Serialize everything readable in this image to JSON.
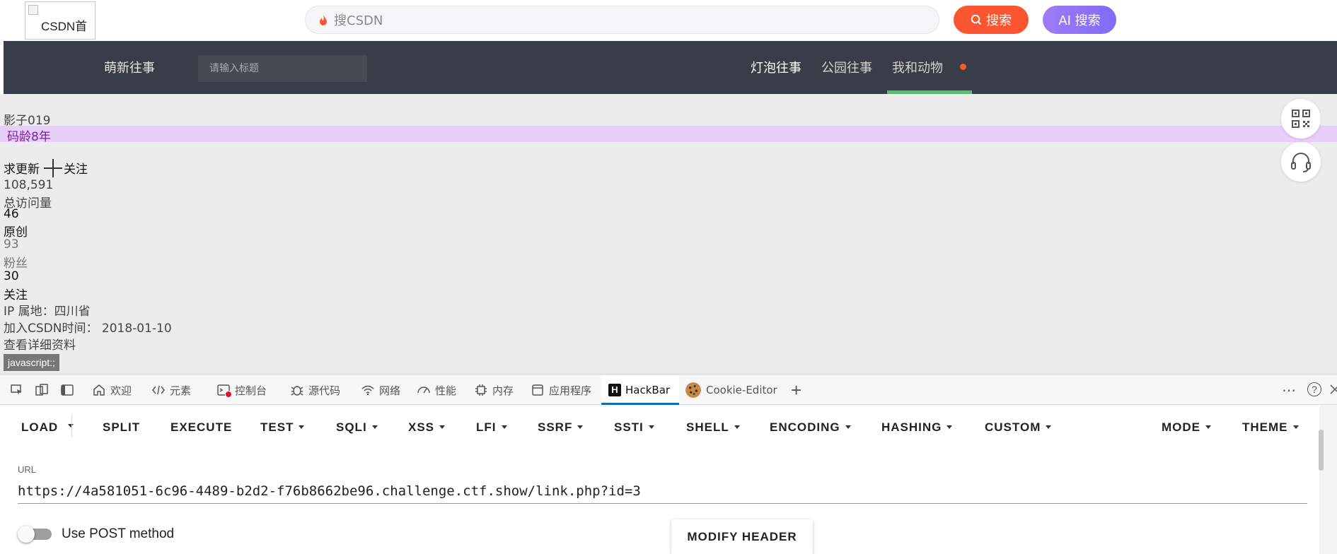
{
  "header": {
    "logo_alt": "CSDN首",
    "search_placeholder": "搜CSDN",
    "search_button": "搜索",
    "ai_button": "AI 搜索"
  },
  "nav": {
    "brand": "萌新往事",
    "search_placeholder": "请输入标题",
    "items": [
      {
        "label": "灯泡往事",
        "active": true
      },
      {
        "label": "公园往事",
        "active": false
      },
      {
        "label": "我和动物",
        "active": false
      }
    ],
    "colors": {
      "bg": "#393d49",
      "underline": "#5fb878",
      "dot": "#ff5722"
    }
  },
  "profile": {
    "username": "影子019",
    "age_badge": "码龄8年",
    "action_text": "求更新",
    "follow_label": "关注",
    "visits_value": "108,591",
    "visits_label": "总访问量",
    "original_value": "46",
    "original_label": "原创",
    "fans_value": "93",
    "fans_label": "粉丝",
    "following_value": "30",
    "following_label": "关注",
    "ip_location": "IP 属地：四川省",
    "join_label": "加入CSDN时间：",
    "join_date": "2018-01-10",
    "details_link": "查看详细资料",
    "status_url": "javascript:;"
  },
  "floating": [
    {
      "icon": "qrcode-icon"
    },
    {
      "icon": "headset-icon"
    }
  ],
  "devtools": {
    "tabs": [
      {
        "label": "欢迎",
        "icon": "home-icon"
      },
      {
        "label": "元素",
        "icon": "code-icon"
      },
      {
        "label": "控制台",
        "icon": "console-icon"
      },
      {
        "label": "源代码",
        "icon": "bug-icon"
      },
      {
        "label": "网络",
        "icon": "wifi-icon"
      },
      {
        "label": "性能",
        "icon": "gauge-icon"
      },
      {
        "label": "内存",
        "icon": "chip-icon"
      },
      {
        "label": "应用程序",
        "icon": "app-icon"
      },
      {
        "label": "HackBar",
        "icon": "hackbar-icon",
        "active": true
      },
      {
        "label": "Cookie-Editor",
        "icon": "cookie-icon"
      }
    ],
    "more": "⋯",
    "help": "?",
    "add": "+"
  },
  "hackbar": {
    "menu": [
      {
        "label": "LOAD",
        "dropdown": false
      },
      {
        "label": "SPLIT",
        "dropdown": false
      },
      {
        "label": "EXECUTE",
        "dropdown": false
      },
      {
        "label": "TEST",
        "dropdown": true
      },
      {
        "label": "SQLI",
        "dropdown": true
      },
      {
        "label": "XSS",
        "dropdown": true
      },
      {
        "label": "LFI",
        "dropdown": true
      },
      {
        "label": "SSRF",
        "dropdown": true
      },
      {
        "label": "SSTI",
        "dropdown": true
      },
      {
        "label": "SHELL",
        "dropdown": true
      },
      {
        "label": "ENCODING",
        "dropdown": true
      },
      {
        "label": "HASHING",
        "dropdown": true
      },
      {
        "label": "CUSTOM",
        "dropdown": true
      },
      {
        "label": "MODE",
        "dropdown": true
      },
      {
        "label": "THEME",
        "dropdown": true
      }
    ],
    "url_label": "URL",
    "url_value": "https://4a581051-6c96-4489-b2d2-f76b8662be96.challenge.ctf.show/link.php?id=3",
    "post_label": "Use POST method",
    "post_enabled": false,
    "modify_header": "MODIFY HEADER"
  }
}
